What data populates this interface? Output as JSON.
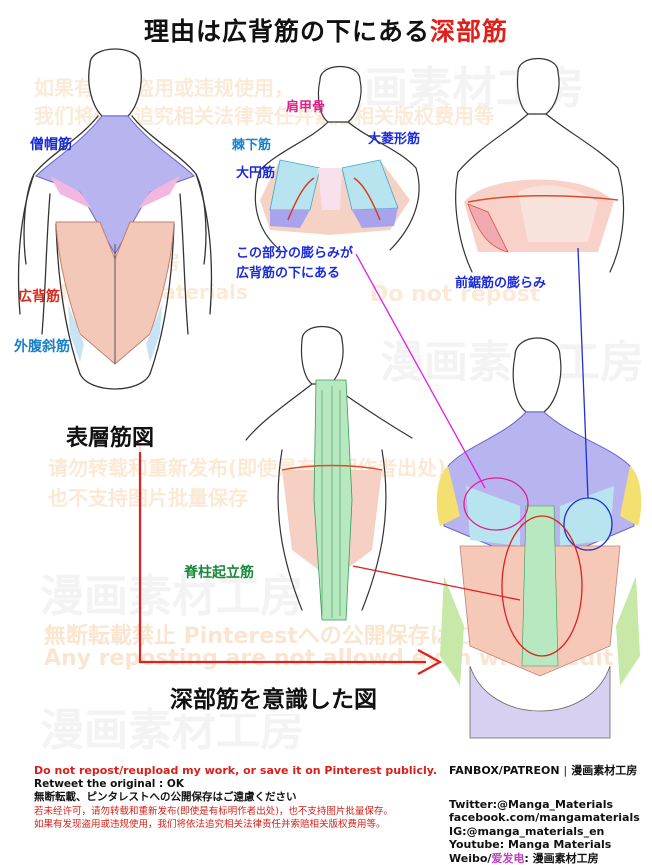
{
  "title": {
    "main": "理由は広背筋の下にある",
    "highlight": "深部筋"
  },
  "watermarks": {
    "zh1": "如果有发现盗用或违规使用，",
    "zh2": "我们将依法追究相关法律责任并索赔相关版权费用等",
    "brand_cn": "漫画素材工房",
    "brand_en": "Manga Materials",
    "no_repost": "Do not repost",
    "zh3": "请勿转载和重新发布(即使是有标明作者出处)",
    "zh4": "也不支持图片批量保存",
    "jp": "無断転載禁止 Pinterestへの公開保存はご遠慮ください",
    "en": "Any reposting are not allowd even with credit"
  },
  "labels": {
    "trapezius": "僧帽筋",
    "latissimus": "広背筋",
    "external_oblique": "外腹斜筋",
    "scapula": "肩甲骨",
    "infraspinatus": "棘下筋",
    "rhomboid": "大菱形筋",
    "teres_major": "大円筋",
    "bulge_note_1": "この部分の膨らみが",
    "bulge_note_2": "広背筋の下にある",
    "serratus_bulge": "前鋸筋の膨らみ",
    "erector_spinae": "脊柱起立筋",
    "surface_diagram": "表層筋図",
    "deep_diagram": "深部筋を意識した図"
  },
  "footer": {
    "warn_en": "Do not repost/reupload my work, or save it on Pinterest publicly.",
    "retweet": "Retweet the original : OK",
    "warn_jp": "無断転載、ピンタレストへの公開保存はご遠慮ください",
    "warn_zh1": "若未经许可，请勿转载和重新发布(即使是有标明作者出处)，也不支持图片批量保存。",
    "warn_zh2": "如果有发现盗用或违规使用，我们将依法追究相关法律责任并索赔相关版权费用等。",
    "fanbox": "FANBOX/PATREON",
    "sep": "|",
    "studio": "漫画素材工房",
    "twitter": "Twitter:@Manga_Materials",
    "facebook": "facebook.com/mangamaterials",
    "instagram": "IG:@manga_materials_en",
    "youtube": "Youtube: Manga Materials",
    "weibo_prefix": "Weibo/",
    "weibo_accent": "爱发电",
    "weibo_suffix": ": 漫画素材工房"
  },
  "colors": {
    "title_highlight": "#e0201a",
    "label_blue": "#1b2bd8",
    "label_pink": "#e0208a",
    "label_red": "#d82a1a",
    "label_green": "#1a8a3a",
    "trapezius_fill": "#b8b4f0",
    "latissimus_fill": "#f4c8b8",
    "oblique_fill": "#c8e4f4",
    "erector_fill": "#b8e8c0"
  }
}
